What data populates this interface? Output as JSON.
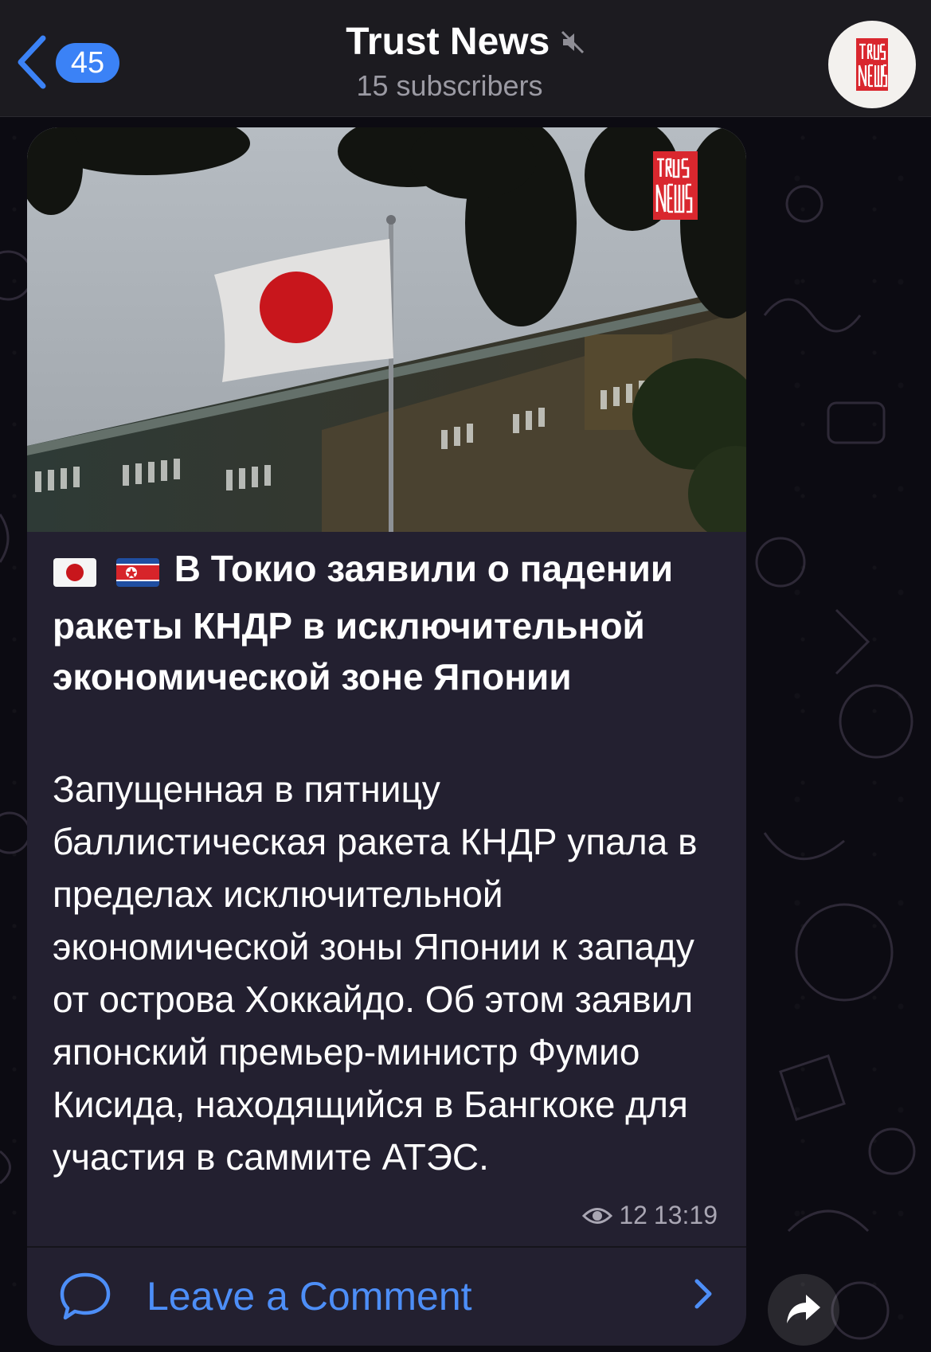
{
  "header": {
    "back_count": "45",
    "title": "Trust News",
    "subtitle": "15 subscribers",
    "avatar_logo_text": "TRUST NEWS"
  },
  "post": {
    "photo_logo_text": "TRUST NEWS",
    "headline": "В Токио заявили о падении ракеты КНДР в исключительной экономической зоне Японии",
    "flags": [
      "🇯🇵",
      "🇰🇵"
    ],
    "body": "Запущенная в пятницу баллистическая ракета КНДР упала в пределах исключительной экономической зоны Японии к западу от острова Хоккайдо. Об этом заявил японский премьер-министр Фумио Кисида, находящийся в Бангкоке для участия в саммите АТЭС.",
    "views": "12",
    "time": "13:19",
    "comment_label": "Leave a Comment"
  },
  "colors": {
    "accent": "#3b82f6",
    "link": "#4d8ef7",
    "bubble": "#232030",
    "header": "#1c1b20",
    "logo_red": "#d9272e"
  },
  "icons": {
    "back": "chevron-left-icon",
    "mute": "mute-icon",
    "views": "eye-icon",
    "comment": "speech-bubble-icon",
    "forward": "chevron-right-icon",
    "share": "share-arrow-icon"
  }
}
